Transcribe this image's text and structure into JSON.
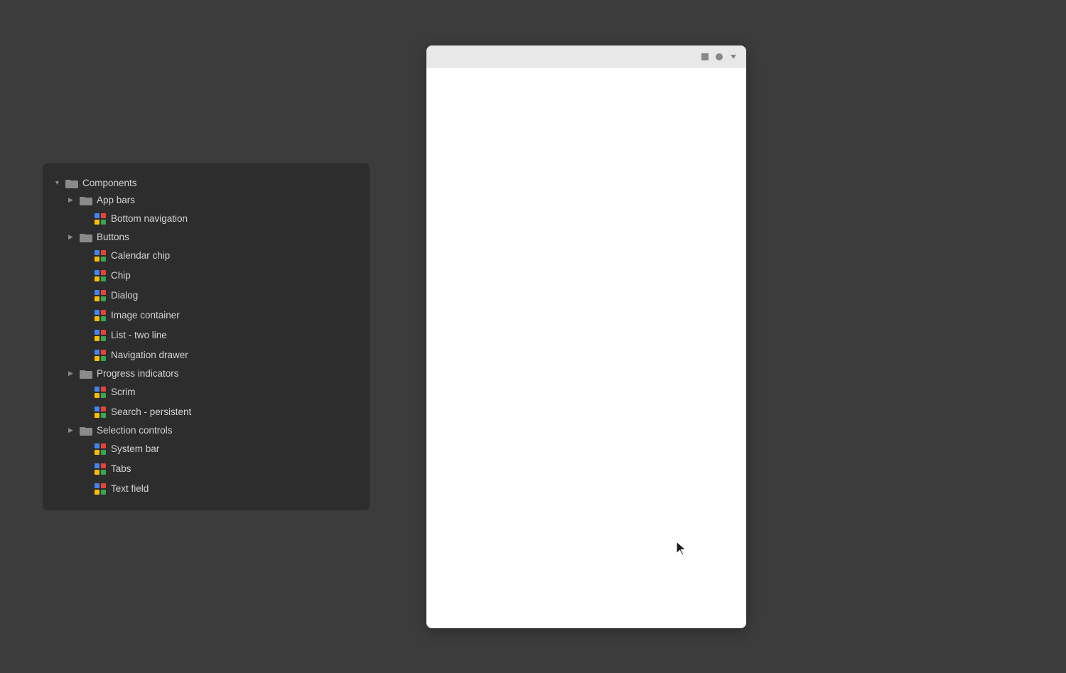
{
  "tree": {
    "root": {
      "label": "Components",
      "expanded": true
    },
    "items": [
      {
        "id": "app-bars",
        "label": "App bars",
        "type": "folder",
        "indent": 1,
        "expanded": true,
        "arrow": "right"
      },
      {
        "id": "bottom-navigation",
        "label": "Bottom navigation",
        "type": "component",
        "indent": 2
      },
      {
        "id": "buttons",
        "label": "Buttons",
        "type": "folder",
        "indent": 1,
        "expanded": true,
        "arrow": "right"
      },
      {
        "id": "calendar-chip",
        "label": "Calendar chip",
        "type": "component",
        "indent": 2
      },
      {
        "id": "chip",
        "label": "Chip",
        "type": "component",
        "indent": 2
      },
      {
        "id": "dialog",
        "label": "Dialog",
        "type": "component",
        "indent": 2
      },
      {
        "id": "image-container",
        "label": "Image container",
        "type": "component",
        "indent": 2
      },
      {
        "id": "list-two-line",
        "label": "List - two line",
        "type": "component",
        "indent": 2
      },
      {
        "id": "navigation-drawer",
        "label": "Navigation drawer",
        "type": "component",
        "indent": 2
      },
      {
        "id": "progress-indicators",
        "label": "Progress indicators",
        "type": "folder",
        "indent": 1,
        "expanded": true,
        "arrow": "right"
      },
      {
        "id": "scrim",
        "label": "Scrim",
        "type": "component",
        "indent": 2
      },
      {
        "id": "search-persistent",
        "label": "Search - persistent",
        "type": "component",
        "indent": 2
      },
      {
        "id": "selection-controls",
        "label": "Selection controls",
        "type": "folder",
        "indent": 1,
        "expanded": true,
        "arrow": "right"
      },
      {
        "id": "system-bar",
        "label": "System bar",
        "type": "component",
        "indent": 2
      },
      {
        "id": "tabs",
        "label": "Tabs",
        "type": "component",
        "indent": 2
      },
      {
        "id": "text-field",
        "label": "Text field",
        "type": "component",
        "indent": 2
      }
    ]
  },
  "preview": {
    "toolbar_buttons": [
      "stop-icon",
      "circle-icon",
      "dropdown-icon"
    ]
  }
}
